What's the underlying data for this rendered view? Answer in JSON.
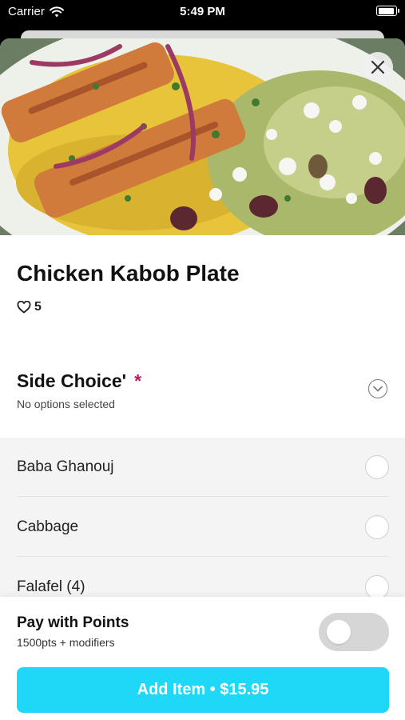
{
  "status_bar": {
    "carrier": "Carrier",
    "time": "5:49 PM"
  },
  "hero": {
    "image_description_icon": "food-photo-image"
  },
  "item": {
    "title": "Chicken Kabob Plate",
    "likes": "5"
  },
  "section": {
    "title": "Side Choice'",
    "required_mark": "*",
    "subtitle": "No options selected"
  },
  "options": [
    {
      "label": "Baba Ghanouj"
    },
    {
      "label": "Cabbage"
    },
    {
      "label": "Falafel (4)"
    }
  ],
  "footer": {
    "points_title": "Pay with Points",
    "points_subtitle": "1500pts + modifiers",
    "add_button_label": "Add Item • $15.95"
  },
  "colors": {
    "accent": "#1fd8f7",
    "required": "#c2185b"
  }
}
